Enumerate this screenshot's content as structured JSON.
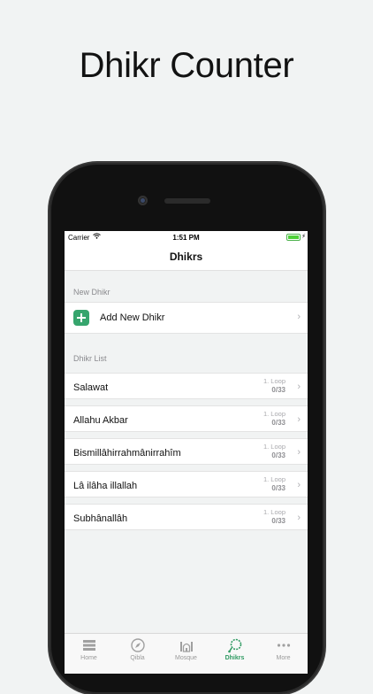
{
  "headline": "Dhikr Counter",
  "status_bar": {
    "carrier": "Carrier",
    "time": "1:51 PM"
  },
  "nav": {
    "title": "Dhikrs"
  },
  "new_section": {
    "header": "New Dhikr",
    "add_label": "Add New Dhikr"
  },
  "list_section": {
    "header": "Dhikr List",
    "items": [
      {
        "name": "Salawat",
        "loop": "1. Loop",
        "count": "0/33"
      },
      {
        "name": "Allahu Akbar",
        "loop": "1. Loop",
        "count": "0/33"
      },
      {
        "name": "Bismillâhirrahmânirrahîm",
        "loop": "1. Loop",
        "count": "0/33"
      },
      {
        "name": "Lâ ilâha illallah",
        "loop": "1. Loop",
        "count": "0/33"
      },
      {
        "name": "Subhânallâh",
        "loop": "1. Loop",
        "count": "0/33"
      }
    ]
  },
  "tabs": [
    {
      "label": "Home",
      "icon": "home-icon",
      "active": false
    },
    {
      "label": "Qibla",
      "icon": "compass-icon",
      "active": false
    },
    {
      "label": "Mosque",
      "icon": "mosque-icon",
      "active": false
    },
    {
      "label": "Dhikrs",
      "icon": "prayer-beads-icon",
      "active": true
    },
    {
      "label": "More",
      "icon": "more-dots-icon",
      "active": false
    }
  ],
  "colors": {
    "accent": "#36a56d",
    "active_tab": "#2f9a62",
    "background": "#f1f3f3"
  }
}
